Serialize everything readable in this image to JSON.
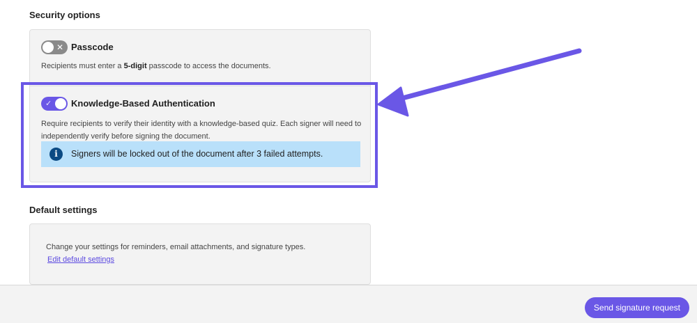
{
  "security": {
    "title": "Security options",
    "passcode": {
      "title": "Passcode",
      "enabled": false,
      "desc_before": "Recipients must enter a ",
      "desc_bold": "5-digit",
      "desc_after": " passcode to access the documents."
    },
    "kba": {
      "title": "Knowledge-Based Authentication",
      "enabled": true,
      "desc": "Require recipients to verify their identity with a knowledge-based quiz. Each signer will need to independently verify before signing the document.",
      "info_icon": "i",
      "info_text": "Signers will be locked out of the document after 3 failed attempts."
    }
  },
  "defaults": {
    "title": "Default settings",
    "desc": "Change your settings for reminders, email attachments, and signature types.",
    "link_label": "Edit default settings"
  },
  "footer": {
    "send_label": "Send signature request"
  },
  "icons": {
    "toggle_off": "close-icon",
    "toggle_on": "check-icon",
    "info": "info-icon"
  },
  "colors": {
    "accent": "#6a57e6",
    "info_bg": "#b9e0fa",
    "info_icon": "#0b4a83"
  }
}
